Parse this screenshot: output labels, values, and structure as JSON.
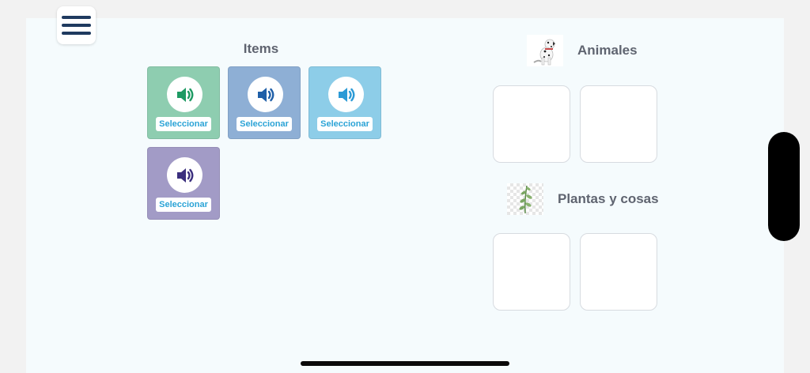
{
  "menu": {
    "icon": "hamburger-menu-icon"
  },
  "items_panel": {
    "title": "Items",
    "cards": [
      {
        "color": "#8ecdb0",
        "icon_color": "#1e9a63",
        "icon": "speaker-icon",
        "select_label": "Seleccionar"
      },
      {
        "color": "#8eafd5",
        "icon_color": "#1f5fa8",
        "icon": "speaker-icon",
        "select_label": "Seleccionar"
      },
      {
        "color": "#8dcde8",
        "icon_color": "#2b9ad6",
        "icon": "speaker-icon",
        "select_label": "Seleccionar"
      },
      {
        "color": "#a29bc6",
        "icon_color": "#3b2f7e",
        "icon": "speaker-icon",
        "select_label": "Seleccionar"
      }
    ]
  },
  "categories": [
    {
      "title": "Animales",
      "image": "dalmatian-dog-image",
      "slots": 2
    },
    {
      "title": "Plantas y cosas",
      "image": "plant-sprig-image",
      "slots": 2
    }
  ]
}
